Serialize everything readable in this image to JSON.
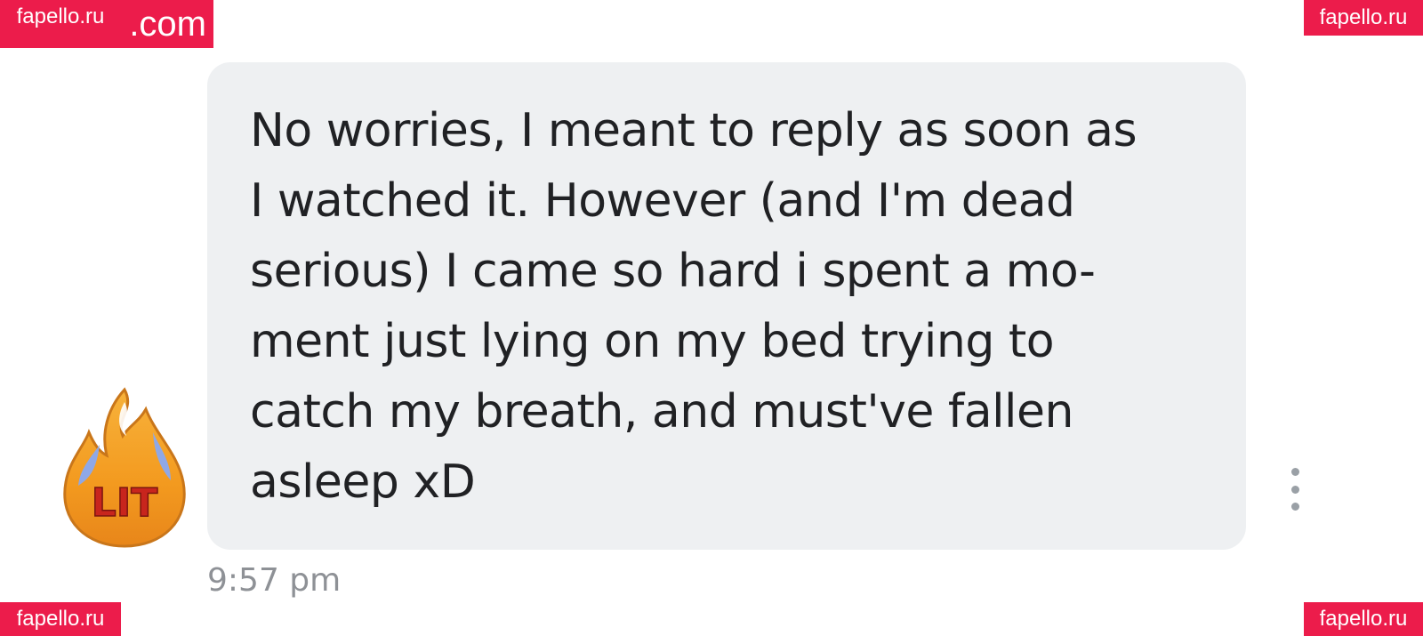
{
  "watermarks": {
    "top_left_large": ".com",
    "top_left_small": "fapello.ru",
    "top_right": "fapello.ru",
    "bottom_left": "fapello.ru",
    "bottom_right": "fapello.ru"
  },
  "message": {
    "text": "No worries, I meant to reply as soon as\nI watched it. However (and I'm dead\nserious) I came so hard i spent a mo-\nment just lying on my bed trying to\ncatch my breath, and must've fallen\nasleep xD",
    "timestamp": "9:57 pm",
    "bubble_color": "#eef0f2"
  },
  "sticker": {
    "icon": "fire-lit-sticker-icon",
    "label": "LIT"
  },
  "actions": {
    "more_icon": "more-vertical-icon"
  },
  "colors": {
    "watermark": "#ec1c4b",
    "text": "#202124",
    "timestamp": "#8e9196"
  }
}
